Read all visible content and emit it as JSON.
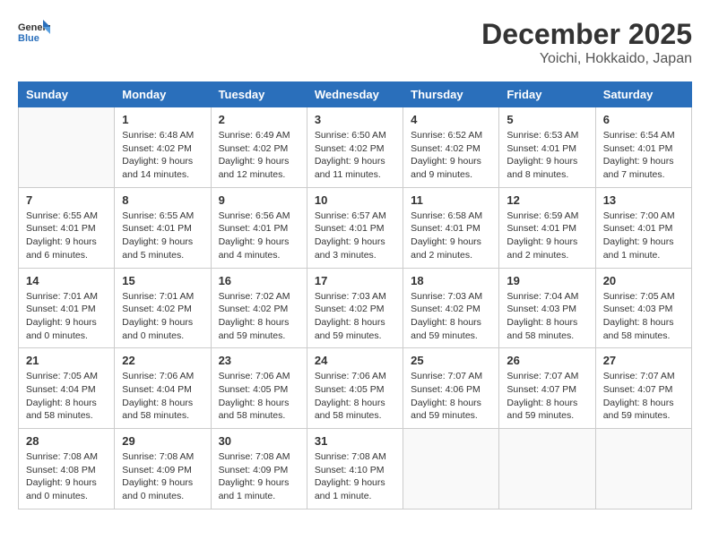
{
  "header": {
    "logo_general": "General",
    "logo_blue": "Blue",
    "month_title": "December 2025",
    "subtitle": "Yoichi, Hokkaido, Japan"
  },
  "days_of_week": [
    "Sunday",
    "Monday",
    "Tuesday",
    "Wednesday",
    "Thursday",
    "Friday",
    "Saturday"
  ],
  "weeks": [
    [
      {
        "day": "",
        "info": ""
      },
      {
        "day": "1",
        "info": "Sunrise: 6:48 AM\nSunset: 4:02 PM\nDaylight: 9 hours\nand 14 minutes."
      },
      {
        "day": "2",
        "info": "Sunrise: 6:49 AM\nSunset: 4:02 PM\nDaylight: 9 hours\nand 12 minutes."
      },
      {
        "day": "3",
        "info": "Sunrise: 6:50 AM\nSunset: 4:02 PM\nDaylight: 9 hours\nand 11 minutes."
      },
      {
        "day": "4",
        "info": "Sunrise: 6:52 AM\nSunset: 4:02 PM\nDaylight: 9 hours\nand 9 minutes."
      },
      {
        "day": "5",
        "info": "Sunrise: 6:53 AM\nSunset: 4:01 PM\nDaylight: 9 hours\nand 8 minutes."
      },
      {
        "day": "6",
        "info": "Sunrise: 6:54 AM\nSunset: 4:01 PM\nDaylight: 9 hours\nand 7 minutes."
      }
    ],
    [
      {
        "day": "7",
        "info": "Sunrise: 6:55 AM\nSunset: 4:01 PM\nDaylight: 9 hours\nand 6 minutes."
      },
      {
        "day": "8",
        "info": "Sunrise: 6:55 AM\nSunset: 4:01 PM\nDaylight: 9 hours\nand 5 minutes."
      },
      {
        "day": "9",
        "info": "Sunrise: 6:56 AM\nSunset: 4:01 PM\nDaylight: 9 hours\nand 4 minutes."
      },
      {
        "day": "10",
        "info": "Sunrise: 6:57 AM\nSunset: 4:01 PM\nDaylight: 9 hours\nand 3 minutes."
      },
      {
        "day": "11",
        "info": "Sunrise: 6:58 AM\nSunset: 4:01 PM\nDaylight: 9 hours\nand 2 minutes."
      },
      {
        "day": "12",
        "info": "Sunrise: 6:59 AM\nSunset: 4:01 PM\nDaylight: 9 hours\nand 2 minutes."
      },
      {
        "day": "13",
        "info": "Sunrise: 7:00 AM\nSunset: 4:01 PM\nDaylight: 9 hours\nand 1 minute."
      }
    ],
    [
      {
        "day": "14",
        "info": "Sunrise: 7:01 AM\nSunset: 4:01 PM\nDaylight: 9 hours\nand 0 minutes."
      },
      {
        "day": "15",
        "info": "Sunrise: 7:01 AM\nSunset: 4:02 PM\nDaylight: 9 hours\nand 0 minutes."
      },
      {
        "day": "16",
        "info": "Sunrise: 7:02 AM\nSunset: 4:02 PM\nDaylight: 8 hours\nand 59 minutes."
      },
      {
        "day": "17",
        "info": "Sunrise: 7:03 AM\nSunset: 4:02 PM\nDaylight: 8 hours\nand 59 minutes."
      },
      {
        "day": "18",
        "info": "Sunrise: 7:03 AM\nSunset: 4:02 PM\nDaylight: 8 hours\nand 59 minutes."
      },
      {
        "day": "19",
        "info": "Sunrise: 7:04 AM\nSunset: 4:03 PM\nDaylight: 8 hours\nand 58 minutes."
      },
      {
        "day": "20",
        "info": "Sunrise: 7:05 AM\nSunset: 4:03 PM\nDaylight: 8 hours\nand 58 minutes."
      }
    ],
    [
      {
        "day": "21",
        "info": "Sunrise: 7:05 AM\nSunset: 4:04 PM\nDaylight: 8 hours\nand 58 minutes."
      },
      {
        "day": "22",
        "info": "Sunrise: 7:06 AM\nSunset: 4:04 PM\nDaylight: 8 hours\nand 58 minutes."
      },
      {
        "day": "23",
        "info": "Sunrise: 7:06 AM\nSunset: 4:05 PM\nDaylight: 8 hours\nand 58 minutes."
      },
      {
        "day": "24",
        "info": "Sunrise: 7:06 AM\nSunset: 4:05 PM\nDaylight: 8 hours\nand 58 minutes."
      },
      {
        "day": "25",
        "info": "Sunrise: 7:07 AM\nSunset: 4:06 PM\nDaylight: 8 hours\nand 59 minutes."
      },
      {
        "day": "26",
        "info": "Sunrise: 7:07 AM\nSunset: 4:07 PM\nDaylight: 8 hours\nand 59 minutes."
      },
      {
        "day": "27",
        "info": "Sunrise: 7:07 AM\nSunset: 4:07 PM\nDaylight: 8 hours\nand 59 minutes."
      }
    ],
    [
      {
        "day": "28",
        "info": "Sunrise: 7:08 AM\nSunset: 4:08 PM\nDaylight: 9 hours\nand 0 minutes."
      },
      {
        "day": "29",
        "info": "Sunrise: 7:08 AM\nSunset: 4:09 PM\nDaylight: 9 hours\nand 0 minutes."
      },
      {
        "day": "30",
        "info": "Sunrise: 7:08 AM\nSunset: 4:09 PM\nDaylight: 9 hours\nand 1 minute."
      },
      {
        "day": "31",
        "info": "Sunrise: 7:08 AM\nSunset: 4:10 PM\nDaylight: 9 hours\nand 1 minute."
      },
      {
        "day": "",
        "info": ""
      },
      {
        "day": "",
        "info": ""
      },
      {
        "day": "",
        "info": ""
      }
    ]
  ]
}
